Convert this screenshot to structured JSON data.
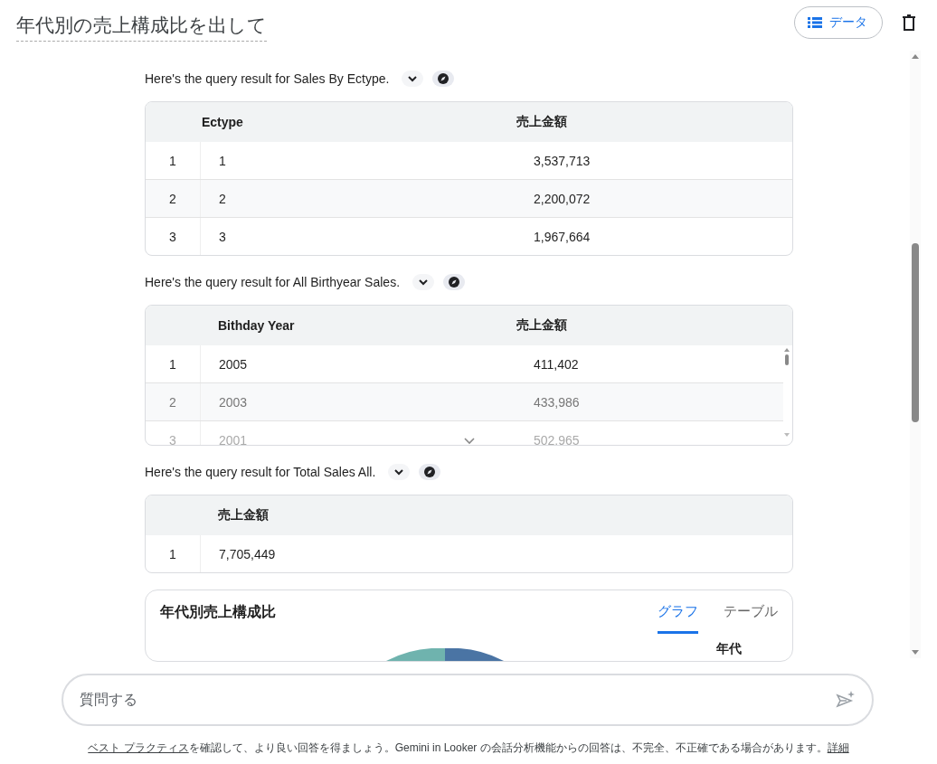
{
  "title": "年代別の売上構成比を出して",
  "data_button": "データ",
  "results": [
    {
      "intro": "Here's the query result for Sales By Ectype.",
      "scrollable": false,
      "columns": [
        "Ectype",
        "売上金額"
      ],
      "rows": [
        {
          "n": "1",
          "cells": [
            "1",
            "3,537,713"
          ]
        },
        {
          "n": "2",
          "cells": [
            "2",
            "2,200,072"
          ]
        },
        {
          "n": "3",
          "cells": [
            "3",
            "1,967,664"
          ]
        }
      ]
    },
    {
      "intro": "Here's the query result for All Birthyear Sales.",
      "scrollable": true,
      "columns": [
        "Bithday Year",
        "売上金額"
      ],
      "rows": [
        {
          "n": "1",
          "cells": [
            "2005",
            "411,402"
          ]
        },
        {
          "n": "2",
          "cells": [
            "2003",
            "433,986"
          ]
        },
        {
          "n": "3",
          "cells": [
            "2001",
            "502,965"
          ]
        }
      ]
    },
    {
      "intro": "Here's the query result for Total Sales All.",
      "scrollable": false,
      "columns": [
        "売上金額"
      ],
      "rows": [
        {
          "n": "1",
          "cells": [
            "7,705,449"
          ]
        }
      ]
    }
  ],
  "chart_card": {
    "title": "年代別売上構成比",
    "tabs": [
      {
        "label": "グラフ",
        "selected": true
      },
      {
        "label": "テーブル",
        "selected": false
      }
    ],
    "legend_title": "年代"
  },
  "input": {
    "placeholder": "質問する"
  },
  "footer": {
    "link": "ベスト プラクティス",
    "text": "を確認して、より良い回答を得ましょう。Gemini in Looker の会話分析機能からの回答は、不完全、不正確である場合があります。",
    "more": "詳細"
  }
}
